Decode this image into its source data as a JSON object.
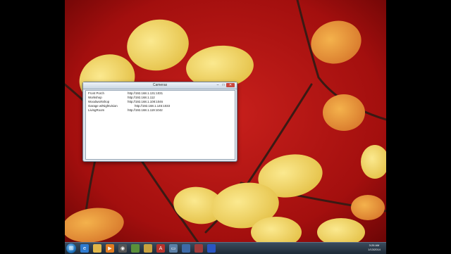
{
  "window": {
    "title": "Cameras",
    "controls": {
      "minimize": "–",
      "maximize": "□",
      "close": "✕"
    },
    "entries": [
      {
        "label": "Front Porch",
        "url": "http://192.168.1.131:1031"
      },
      {
        "label": "Workshop",
        "url": "http://192.168.1.112"
      },
      {
        "label": "Woodworkshop",
        "url": "http://192.168.1.108:1046"
      },
      {
        "label": "Garage w/Nightvision",
        "url": "http://192.168.1.145:1033"
      },
      {
        "label": "LivingRoom",
        "url": "http://192.168.1.119:1042"
      }
    ]
  },
  "taskbar": {
    "start_icon": "windows-orb",
    "buttons": [
      {
        "icon": "ie-icon"
      },
      {
        "icon": "folder-icon"
      },
      {
        "icon": "media-player-icon"
      },
      {
        "icon": "camera-icon"
      },
      {
        "icon": "folder-icon"
      },
      {
        "icon": "paint-icon"
      },
      {
        "icon": "word-icon"
      },
      {
        "icon": "monitor-icon"
      },
      {
        "icon": "app-icon"
      },
      {
        "icon": "app-icon"
      },
      {
        "icon": "app-icon"
      }
    ],
    "clock_time": "3:26 AM",
    "clock_date": "1/13/2014"
  },
  "colors": {
    "wallpaper_red": "#b01210",
    "leaf_yellow": "#f2d86a",
    "taskbar": "#2a3a4b"
  }
}
